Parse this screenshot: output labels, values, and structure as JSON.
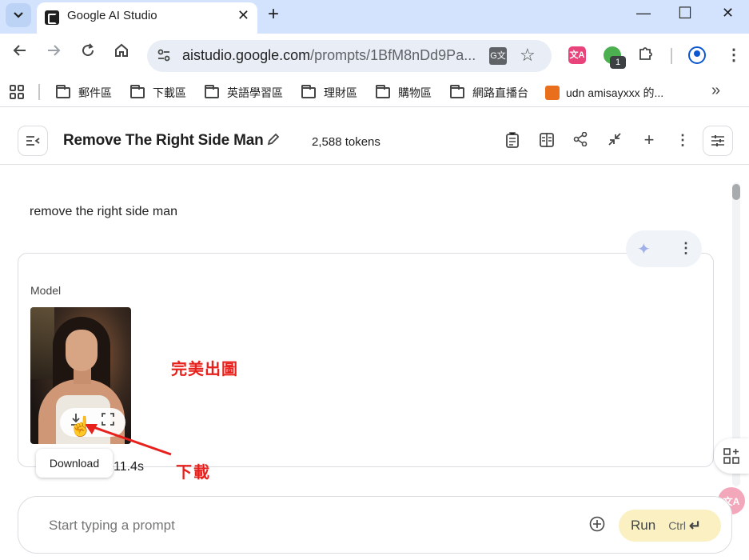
{
  "browser": {
    "tab": {
      "title": "Google AI Studio"
    },
    "url": {
      "host": "aistudio.google.com",
      "path": "/prompts/1BfM8nDd9Pa..."
    },
    "bookmarks": [
      {
        "label": "郵件區"
      },
      {
        "label": "下載區"
      },
      {
        "label": "英語學習區"
      },
      {
        "label": "理財區"
      },
      {
        "label": "購物區"
      },
      {
        "label": "網路直播台"
      },
      {
        "label": "udn amisayxxx 的..."
      }
    ],
    "extension_badge": "1",
    "translate_label": "G文",
    "ext_pink_label": "文A"
  },
  "header": {
    "title": "Remove The Right Side Man",
    "tokens": "2,588 tokens"
  },
  "chat": {
    "user_message": "remove the right side man",
    "model_label": "Model",
    "tooltip": "Download",
    "elapsed": "11.4s"
  },
  "annotations": {
    "perfect": "完美出圖",
    "download": "下載",
    "color": "#e8201c"
  },
  "composer": {
    "placeholder": "Start typing a prompt",
    "run_label": "Run",
    "run_shortcut": "Ctrl"
  },
  "icons": {
    "tab_menu": "chevron-down-icon",
    "back": "arrow-left-icon",
    "forward": "arrow-right-icon",
    "reload": "reload-icon",
    "home": "home-icon",
    "star": "star-icon",
    "apps": "apps-grid-icon",
    "edit": "pencil-icon",
    "sparkle": "sparkle-icon",
    "download": "download-icon",
    "fullscreen": "fullscreen-icon",
    "add": "add-circle-icon"
  }
}
